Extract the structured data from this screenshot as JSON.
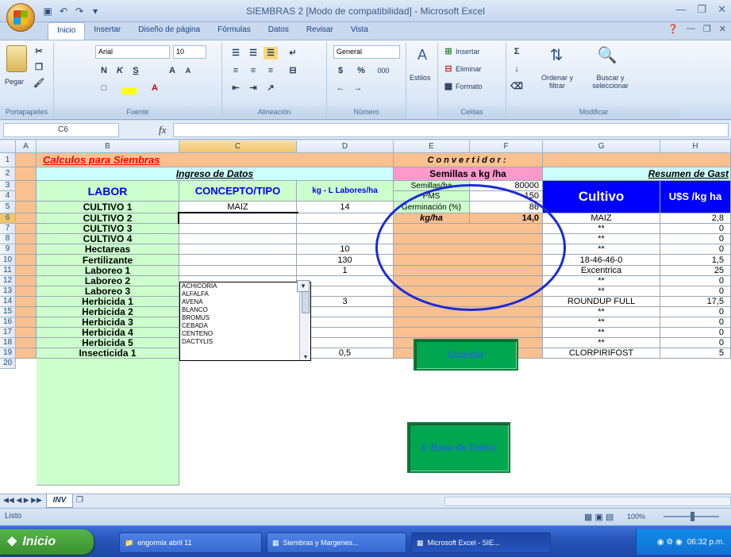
{
  "window": {
    "title": "SIEMBRAS 2  [Modo de compatibilidad] - Microsoft Excel"
  },
  "ribbon_tabs": [
    "Inicio",
    "Insertar",
    "Diseño de página",
    "Fórmulas",
    "Datos",
    "Revisar",
    "Vista"
  ],
  "ribbon": {
    "paste_label": "Pegar",
    "clipboard_label": "Portapapeles",
    "font_name": "Arial",
    "font_size": "10",
    "font_group_label": "Fuente",
    "align_group_label": "Alineación",
    "number_format": "General",
    "number_group_label": "Número",
    "styles_label": "Estilos",
    "insert_label": "Insertar",
    "delete_label": "Eliminar",
    "format_label": "Formato",
    "cells_group_label": "Celdas",
    "sort_filter_label": "Ordenar y filtrar",
    "find_select_label": "Buscar y seleccionar",
    "modify_group_label": "Modificar",
    "bold": "N",
    "italic": "K",
    "underline": "S",
    "grow": "A",
    "shrink": "A",
    "currency": "$",
    "percent": "%",
    "thousands": "000"
  },
  "formula_bar": {
    "cell_ref": "C6",
    "fx": "fx",
    "value": ""
  },
  "columns": [
    "A",
    "B",
    "C",
    "D",
    "E",
    "F",
    "G",
    "H"
  ],
  "rows": [
    "1",
    "2",
    "3",
    "4",
    "5",
    "6",
    "7",
    "8",
    "9",
    "10",
    "11",
    "12",
    "13",
    "14",
    "15",
    "16",
    "17",
    "18",
    "19",
    "20"
  ],
  "sheet": {
    "title": "Calculos para Siembras",
    "ingreso": "Ingreso de Datos",
    "labor_hdr": "LABOR",
    "concepto_hdr": "CONCEPTO/TIPO",
    "kg_hdr": "kg - L Labores/ha",
    "labor_rows": [
      {
        "labor": "CULTIVO 1",
        "concepto": "MAIZ",
        "kg": "14"
      },
      {
        "labor": "CULTIVO 2",
        "concepto": "",
        "kg": ""
      },
      {
        "labor": "CULTIVO 3",
        "concepto": "",
        "kg": ""
      },
      {
        "labor": "CULTIVO 4",
        "concepto": "",
        "kg": ""
      },
      {
        "labor": "Hectareas",
        "concepto": "",
        "kg": "10"
      },
      {
        "labor": "Fertilizante",
        "concepto": "",
        "kg": "130"
      },
      {
        "labor": "Laboreo 1",
        "concepto": "",
        "kg": "1"
      },
      {
        "labor": "Laboreo 2",
        "concepto": "",
        "kg": ""
      },
      {
        "labor": "Laboreo 3",
        "concepto": "",
        "kg": ""
      },
      {
        "labor": "Herbicida 1",
        "concepto": "ROUNDUP FULL",
        "kg": "3"
      },
      {
        "labor": "Herbicida 2",
        "concepto": "",
        "kg": ""
      },
      {
        "labor": "Herbicida 3",
        "concepto": "",
        "kg": ""
      },
      {
        "labor": "Herbicida 4",
        "concepto": "",
        "kg": ""
      },
      {
        "labor": "Herbicida 5",
        "concepto": "",
        "kg": ""
      },
      {
        "labor": "Insecticida 1",
        "concepto": "CLORPIRIFOST",
        "kg": "0,5"
      }
    ],
    "convertidor": "Convertidor:",
    "semillas_hdr": "Semillas a kg /ha",
    "conv_rows": [
      {
        "label": "Semillas/ha",
        "value": "80000"
      },
      {
        "label": "PMS",
        "value": "150"
      },
      {
        "label": "Germinación (%)",
        "value": "86"
      },
      {
        "label": "kg/ha",
        "value": "14,0"
      }
    ],
    "guardar": "Guardar",
    "ir_base": "Ir Base de Datos",
    "resumen": "Resumen de Gast",
    "cultivo_hdr": "Cultivo",
    "uss_hdr": "U$S /kg ha",
    "resumen_rows": [
      {
        "g": "MAIZ",
        "h": "2,8"
      },
      {
        "g": "**",
        "h": "0"
      },
      {
        "g": "**",
        "h": "0"
      },
      {
        "g": "**",
        "h": "0"
      },
      {
        "g": "18-46-46-0",
        "h": "1,5"
      },
      {
        "g": "Excentrica",
        "h": "25"
      },
      {
        "g": "**",
        "h": "0"
      },
      {
        "g": "**",
        "h": "0"
      },
      {
        "g": "ROUNDUP FULL",
        "h": "17,5"
      },
      {
        "g": "**",
        "h": "0"
      },
      {
        "g": "**",
        "h": "0"
      },
      {
        "g": "**",
        "h": "0"
      },
      {
        "g": "**",
        "h": "0"
      },
      {
        "g": "CLORPIRIFOST",
        "h": "5"
      }
    ],
    "dropdown_options": [
      "ACHICORIA",
      "ALFALFA",
      "AVENA",
      "BLANCO",
      "BROMUS",
      "CEBADA",
      "CENTENO",
      "DACTYLIS"
    ]
  },
  "sheet_tab": "INV",
  "status": {
    "left": "Listo",
    "zoom": "100%"
  },
  "taskbar": {
    "start": "Inicio",
    "tasks": [
      "engormix abril 11",
      "Siembras y Margenes...",
      "Microsoft Excel - SIE..."
    ],
    "clock": "06:32 p.m."
  },
  "colors": {
    "accent_blue": "#1a2bd9",
    "cultivo_header": "#0000ff",
    "title_red": "#ff0000"
  }
}
